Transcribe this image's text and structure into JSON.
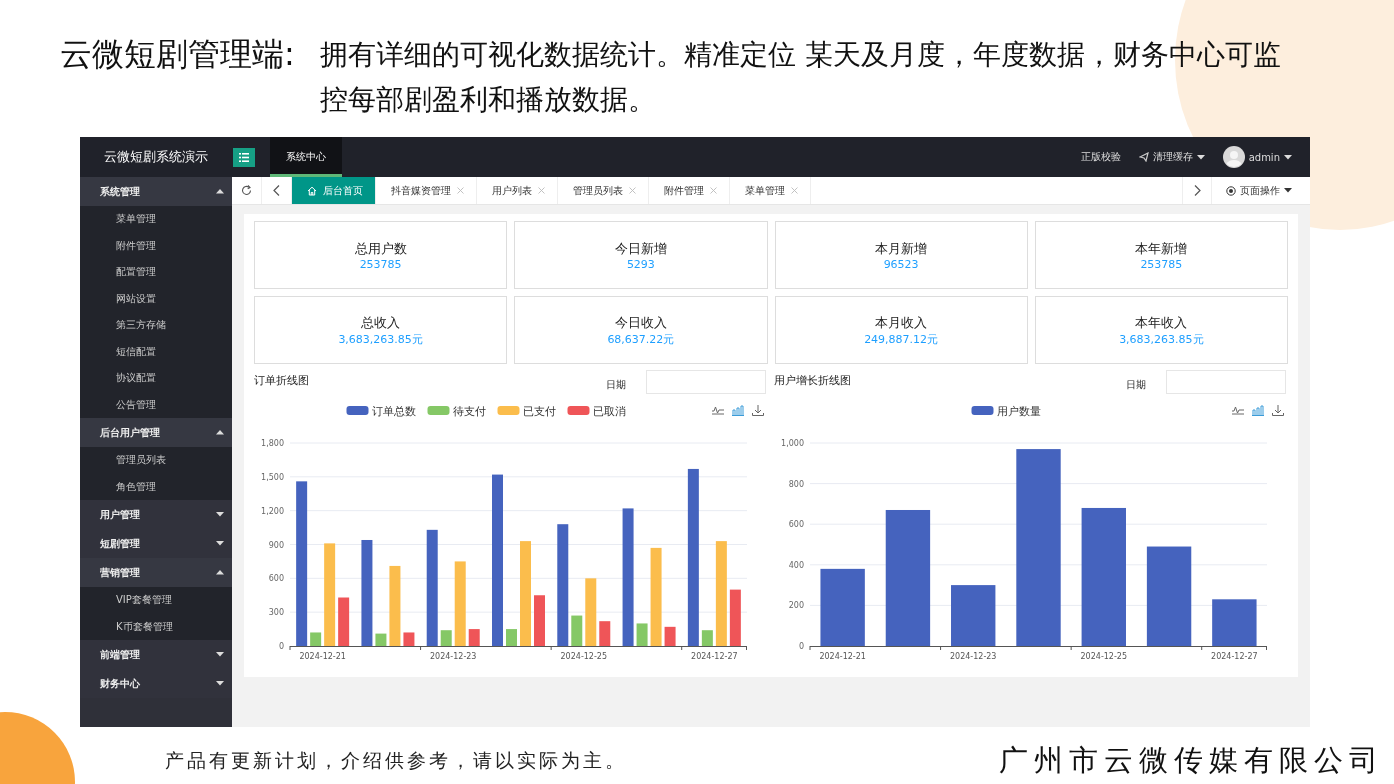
{
  "slide": {
    "heading": "云微短剧管理端:",
    "description": "拥有详细的可视化数据统计。精准定位 某天及月度，年度数据，财务中心可监控每部剧盈利和播放数据。",
    "note": "产品有更新计划，介绍供参考，请以实际为主。",
    "company": "广州市云微传媒有限公司"
  },
  "topbar": {
    "brand": "云微短剧系统演示",
    "nav": [
      {
        "label": "系统中心",
        "selected": true
      }
    ],
    "actions": [
      {
        "kind": "text",
        "label": "正版校验"
      },
      {
        "kind": "dropdown",
        "label": "清理缓存"
      },
      {
        "kind": "user",
        "label": "admin"
      }
    ]
  },
  "sidebar": {
    "groups": [
      {
        "label": "系统管理",
        "expanded": true,
        "children": [
          "菜单管理",
          "附件管理",
          "配置管理",
          "网站设置",
          "第三方存储",
          "短信配置",
          "协议配置",
          "公告管理"
        ]
      },
      {
        "label": "后台用户管理",
        "expanded": true,
        "children": [
          "管理员列表",
          "角色管理"
        ]
      },
      {
        "label": "用户管理",
        "expanded": false
      },
      {
        "label": "短剧管理",
        "expanded": false
      },
      {
        "label": "营销管理",
        "expanded": true,
        "children": [
          "VIP套餐管理",
          "K币套餐管理"
        ]
      },
      {
        "label": "前端管理",
        "expanded": false
      },
      {
        "label": "财务中心",
        "expanded": false
      }
    ]
  },
  "tabs": [
    {
      "label": "后台首页",
      "selected": true,
      "closable": false
    },
    {
      "label": "抖音媒资管理",
      "selected": false,
      "closable": true
    },
    {
      "label": "用户列表",
      "selected": false,
      "closable": true
    },
    {
      "label": "管理员列表",
      "selected": false,
      "closable": true
    },
    {
      "label": "附件管理",
      "selected": false,
      "closable": true
    },
    {
      "label": "菜单管理",
      "selected": false,
      "closable": true
    }
  ],
  "page_actions": "页面操作",
  "stats": [
    {
      "label": "总用户数",
      "value": "253785"
    },
    {
      "label": "今日新增",
      "value": "5293"
    },
    {
      "label": "本月新增",
      "value": "96523"
    },
    {
      "label": "本年新增",
      "value": "253785"
    },
    {
      "label": "总收入",
      "value": "3,683,263.85元"
    },
    {
      "label": "今日收入",
      "value": "68,637.22元"
    },
    {
      "label": "本月收入",
      "value": "249,887.12元"
    },
    {
      "label": "本年收入",
      "value": "3,683,263.85元"
    }
  ],
  "charts": [
    {
      "date_label": "日期",
      "chart_data": {
        "type": "bar",
        "title": "订单折线图",
        "ylim": [
          0,
          1800
        ],
        "yticks": [
          0,
          300,
          600,
          900,
          {
            "value": 1200,
            "label": "1,200"
          },
          {
            "value": 1500,
            "label": "1,500"
          },
          {
            "value": 1800,
            "label": "1,800"
          }
        ],
        "categories": [
          "2024-12-21",
          null,
          "2024-12-23",
          null,
          "2024-12-25",
          null,
          "2024-12-27"
        ],
        "grid": true,
        "legend": true,
        "series": [
          {
            "name": "订单总数",
            "color": "#4563be",
            "values": [
              1460,
              940,
              1030,
              1520,
              1080,
              1220,
              1570
            ]
          },
          {
            "name": "待支付",
            "color": "#85c866",
            "values": [
              120,
              110,
              140,
              150,
              270,
              200,
              140
            ]
          },
          {
            "name": "已支付",
            "color": "#fbbd4c",
            "values": [
              910,
              710,
              750,
              930,
              600,
              870,
              930
            ]
          },
          {
            "name": "已取消",
            "color": "#ef5558",
            "values": [
              430,
              120,
              150,
              450,
              220,
              170,
              500
            ]
          }
        ]
      }
    },
    {
      "date_label": "日期",
      "chart_data": {
        "type": "bar",
        "title": "用户增长折线图",
        "ylim": [
          0,
          1000
        ],
        "yticks": [
          0,
          200,
          400,
          600,
          800,
          {
            "value": 1000,
            "label": "1,000"
          }
        ],
        "categories": [
          "2024-12-21",
          null,
          "2024-12-23",
          null,
          "2024-12-25",
          null,
          "2024-12-27"
        ],
        "grid": true,
        "legend": true,
        "series": [
          {
            "name": "用户数量",
            "color": "#4563be",
            "values": [
              380,
              670,
              300,
              970,
              680,
              490,
              230
            ]
          }
        ]
      }
    }
  ]
}
